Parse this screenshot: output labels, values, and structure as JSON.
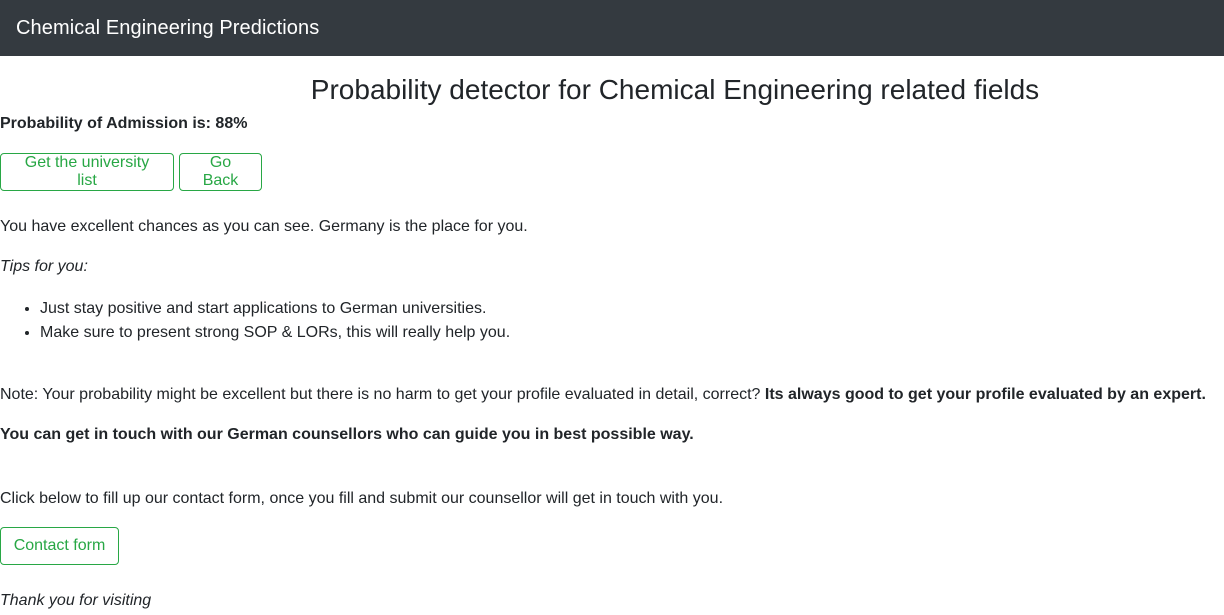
{
  "navbar": {
    "brand": "Chemical Engineering Predictions"
  },
  "main": {
    "title": "Probability detector for Chemical Engineering related fields",
    "probability_text": "Probability of Admission is: 88%",
    "buttons": {
      "university_list": "Get the university list",
      "go_back": "Go Back",
      "contact_form": "Contact form"
    },
    "excellent_text": "You have excellent chances as you can see. Germany is the place for you.",
    "tips_heading": "Tips for you:",
    "tips": [
      "Just stay positive and start applications to German universities.",
      "Make sure to present strong SOP & LORs, this will really help you."
    ],
    "note_text": "Note: Your probability might be excellent but there is no harm to get your profile evaluated in detail, correct? ",
    "note_bold": "Its always good to get your profile evaluated by an expert.",
    "touch_text": "You can get in touch with our German counsellors who can guide you in best possible way.",
    "click_text": "Click below to fill up our contact form, once you fill and submit our counsellor will get in touch with you.",
    "thanks_text": "Thank you for visiting"
  },
  "colors": {
    "navbar_bg": "#343a40",
    "accent_green": "#28a745",
    "text": "#212529"
  }
}
